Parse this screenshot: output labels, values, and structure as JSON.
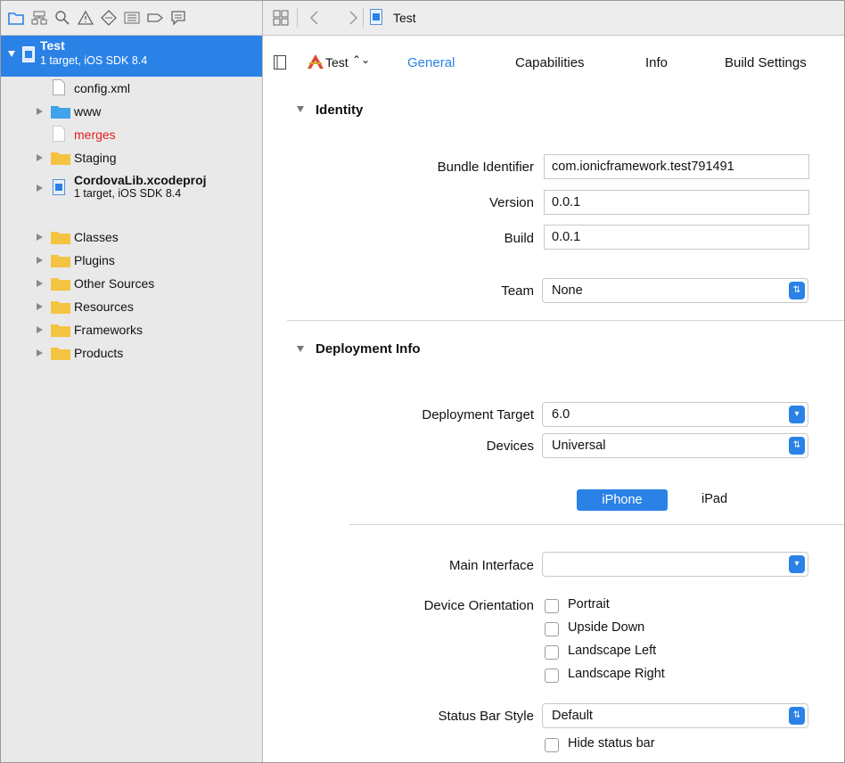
{
  "navigator": {
    "project": {
      "name": "Test",
      "subtitle": "1 target, iOS SDK 8.4"
    },
    "items": [
      {
        "label": "config.xml",
        "kind": "file"
      },
      {
        "label": "www",
        "kind": "folder-blue"
      },
      {
        "label": "merges",
        "kind": "file-missing"
      },
      {
        "label": "Staging",
        "kind": "folder"
      },
      {
        "label": "CordovaLib.xcodeproj",
        "subtitle": "1 target, iOS SDK 8.4",
        "kind": "project"
      },
      {
        "label": "Classes",
        "kind": "folder"
      },
      {
        "label": "Plugins",
        "kind": "folder"
      },
      {
        "label": "Other Sources",
        "kind": "folder"
      },
      {
        "label": "Resources",
        "kind": "folder"
      },
      {
        "label": "Frameworks",
        "kind": "folder"
      },
      {
        "label": "Products",
        "kind": "folder"
      }
    ],
    "toolbar_icons": [
      "folder-icon",
      "hierarchy-icon",
      "search-icon",
      "warning-icon",
      "test-diamond-icon",
      "debug-icon",
      "breakpoint-icon",
      "log-icon"
    ]
  },
  "jumpbar": {
    "file": "Test"
  },
  "tabs": {
    "target": "Test",
    "general": "General",
    "capabilities": "Capabilities",
    "info": "Info",
    "build_settings": "Build Settings"
  },
  "identity": {
    "title": "Identity",
    "bundle_label": "Bundle Identifier",
    "bundle_value": "com.ionicframework.test791491",
    "version_label": "Version",
    "version_value": "0.0.1",
    "build_label": "Build",
    "build_value": "0.0.1",
    "team_label": "Team",
    "team_value": "None"
  },
  "deployment": {
    "title": "Deployment Info",
    "target_label": "Deployment Target",
    "target_value": "6.0",
    "devices_label": "Devices",
    "devices_value": "Universal",
    "seg_iphone": "iPhone",
    "seg_ipad": "iPad",
    "main_interface_label": "Main Interface",
    "main_interface_value": "",
    "orientation_label": "Device Orientation",
    "orientations": [
      "Portrait",
      "Upside Down",
      "Landscape Left",
      "Landscape Right"
    ],
    "status_bar_label": "Status Bar Style",
    "status_bar_value": "Default",
    "hide_status_bar": "Hide status bar"
  },
  "colors": {
    "accent": "#2a82e6",
    "missing_file": "#e0201c",
    "folder": "#f5c342",
    "folder_blue": "#3ea3e8"
  }
}
